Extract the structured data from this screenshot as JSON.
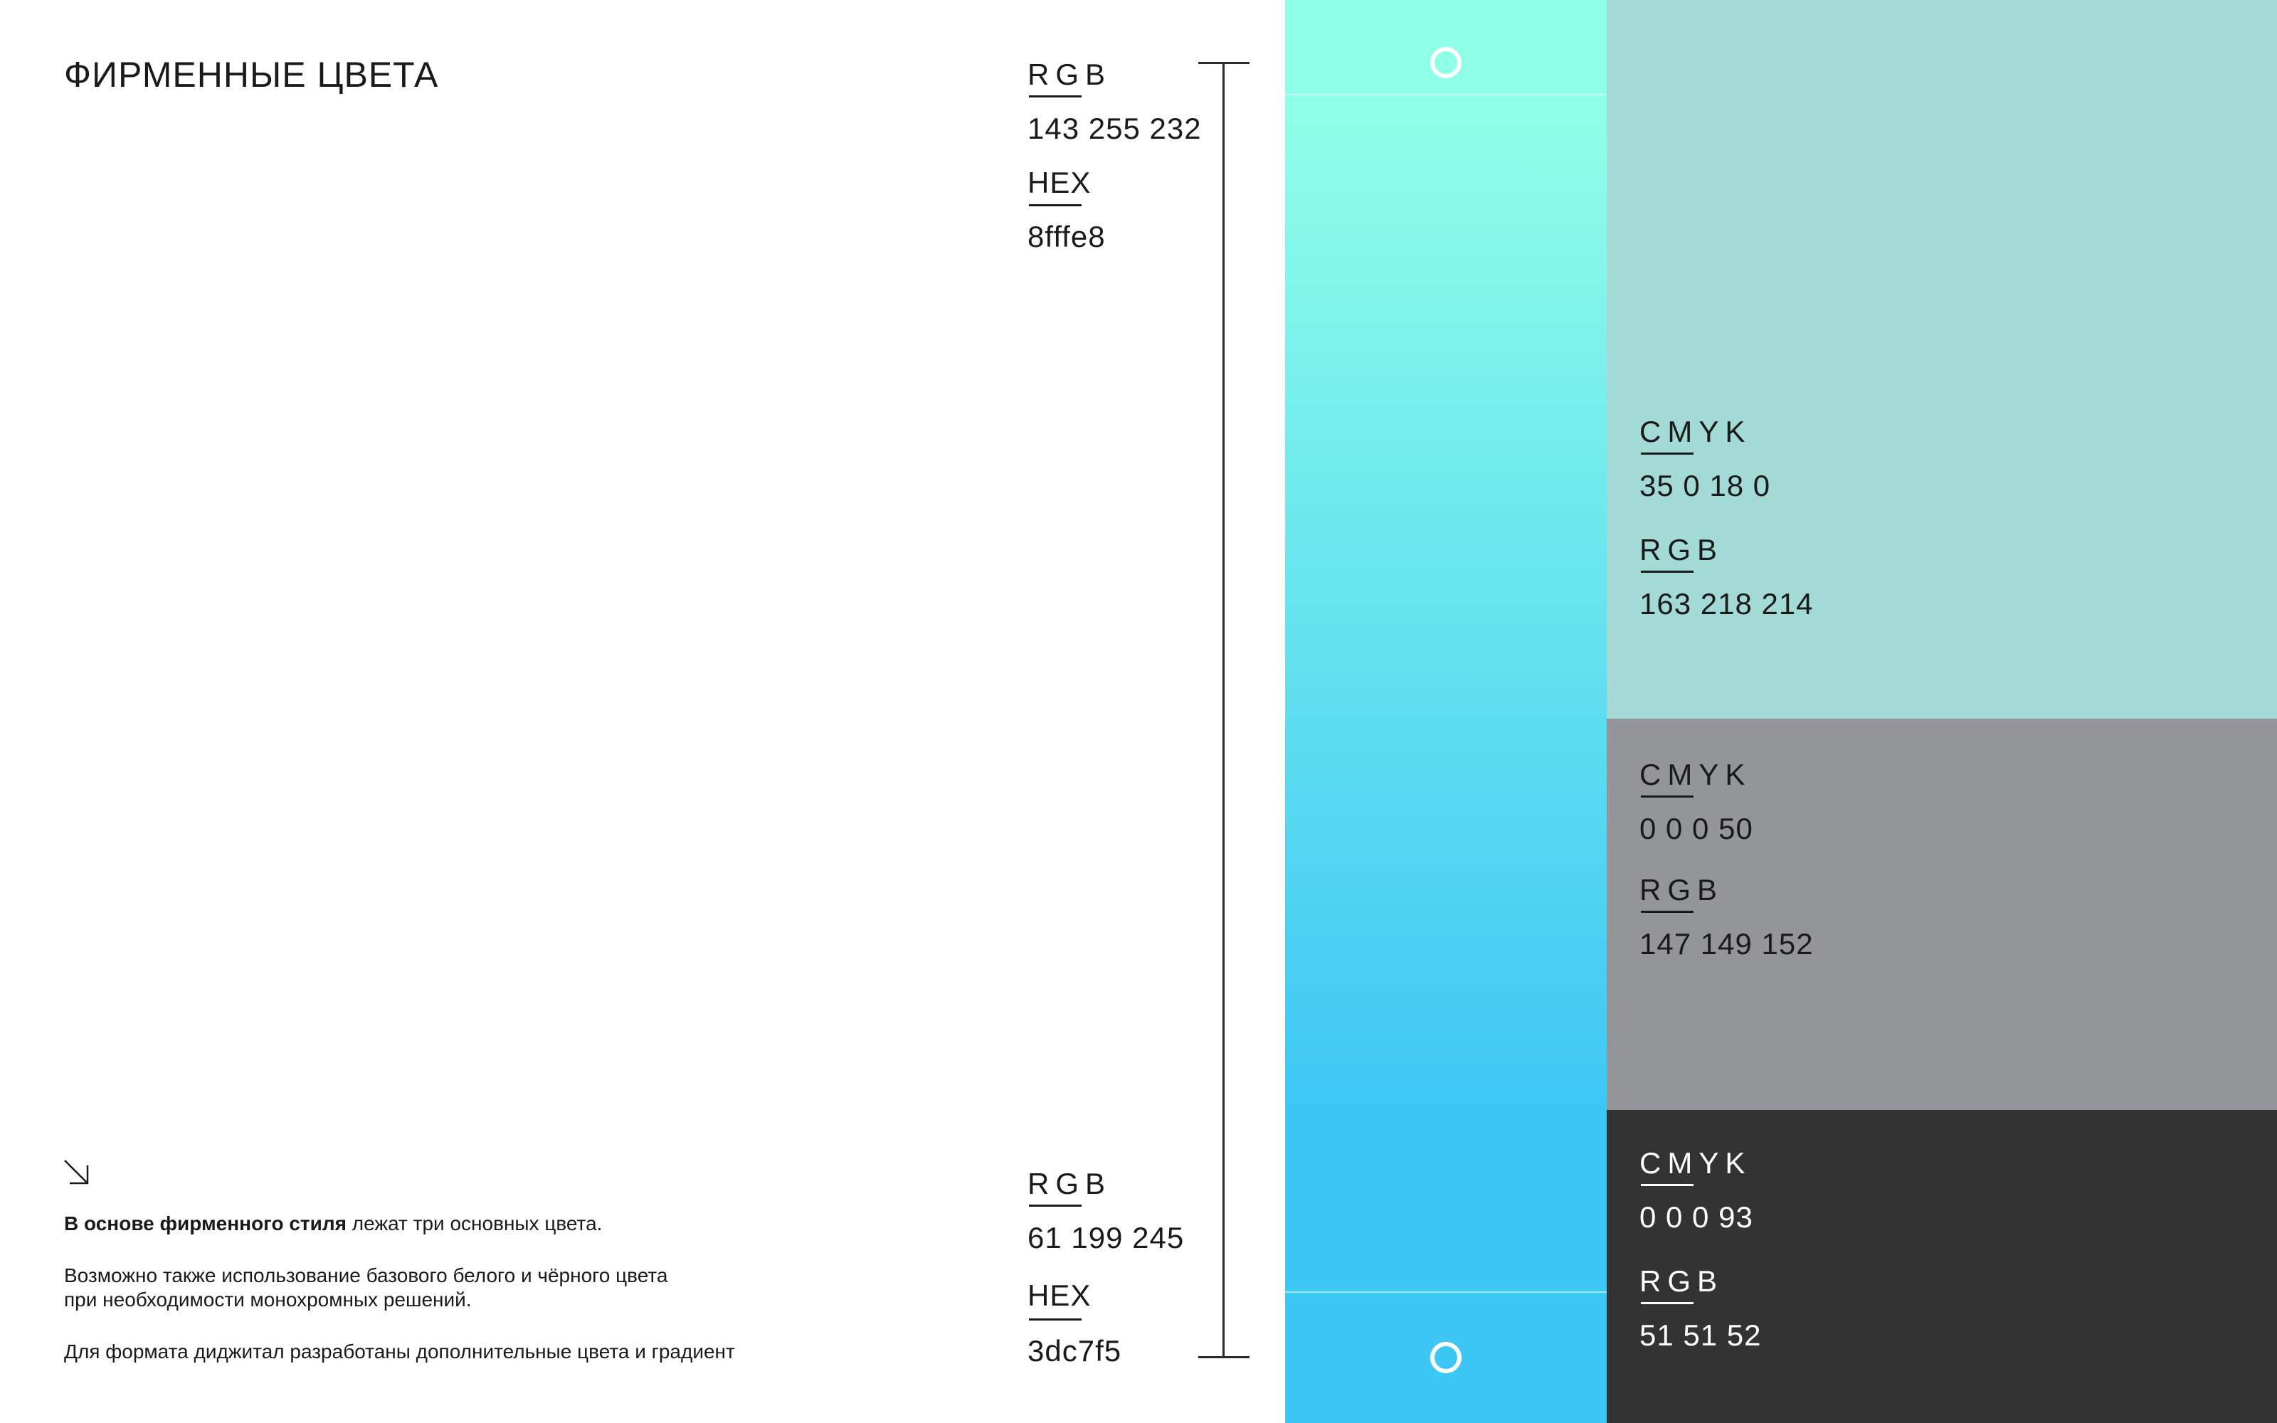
{
  "title": "ФИРМЕННЫЕ ЦВЕТА",
  "primary_top": {
    "rgb_label": "RGB",
    "rgb_value": "143 255 232",
    "hex_label": "HEX",
    "hex_value": "8fffe8"
  },
  "primary_bottom": {
    "rgb_label": "RGB",
    "rgb_value": "61 199 245",
    "hex_label": "HEX",
    "hex_value": "3dc7f5"
  },
  "description": {
    "line1_bold": "В основе фирменного стиля",
    "line1_rest": " лежат три основных цвета.",
    "line2": "Возможно также использование базового белого и чёрного цвета",
    "line3": "при необходимости монохромных решений.",
    "line4": "Для формата диджитал разработаны дополнительные цвета и градиент"
  },
  "swatches": [
    {
      "cmyk_label": "CMYK",
      "cmyk_value": "35 0 18 0",
      "rgb_label": "RGB",
      "rgb_value": "163 218 214",
      "color": "#a3dad6"
    },
    {
      "cmyk_label": "CMYK",
      "cmyk_value": "0 0 0 50",
      "rgb_label": "RGB",
      "rgb_value": "147 149 152",
      "color": "#939598"
    },
    {
      "cmyk_label": "CMYK",
      "cmyk_value": "0 0 0 93",
      "rgb_label": "RGB",
      "rgb_value": "51 51 52",
      "color": "#333334"
    }
  ],
  "gradient": {
    "from": "#8fffe8",
    "to": "#3dc7f5"
  },
  "icons": {
    "arrow": "arrow-down-right-icon",
    "ring": "circle-outline-icon"
  }
}
